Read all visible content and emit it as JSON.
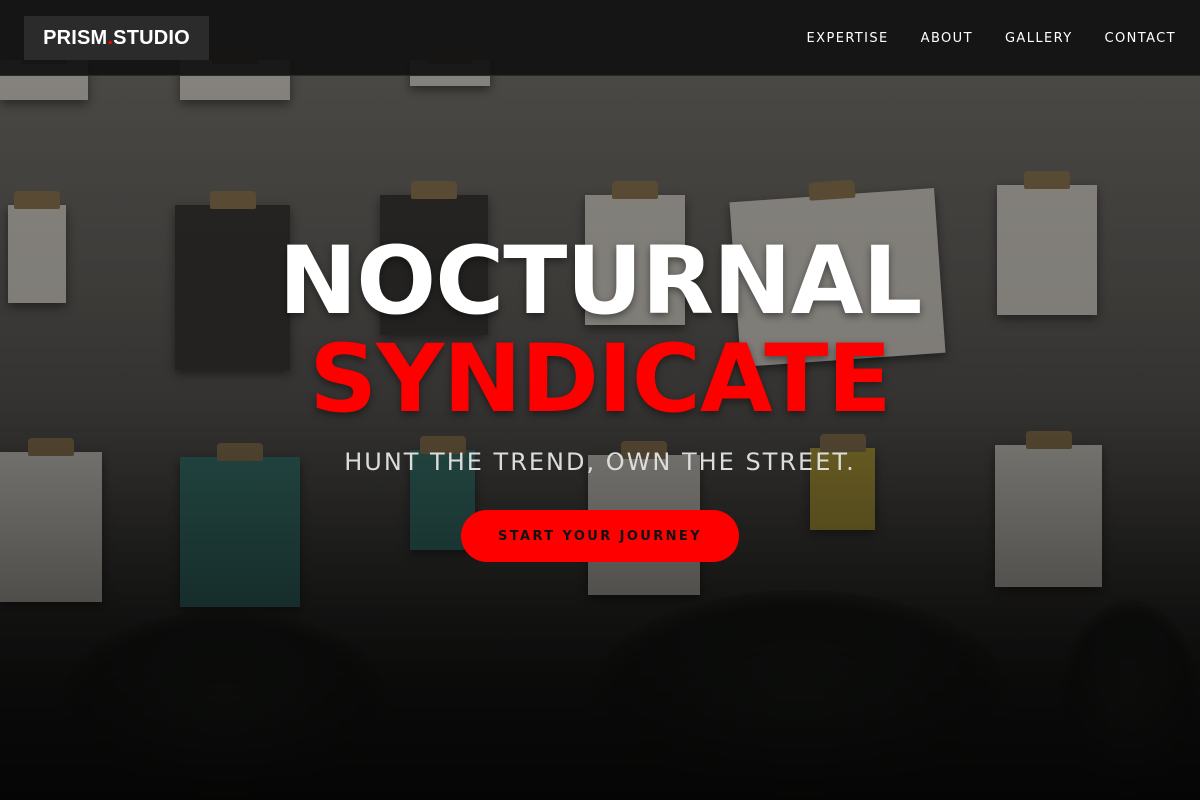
{
  "brand": {
    "name_part1": "PRISM",
    "dot": ".",
    "name_part2": "STUDIO",
    "accent_color": "#ff0000"
  },
  "nav": {
    "items": [
      {
        "label": "EXPERTISE"
      },
      {
        "label": "ABOUT"
      },
      {
        "label": "GALLERY"
      },
      {
        "label": "CONTACT"
      }
    ]
  },
  "hero": {
    "title_line1": "NOCTURNAL",
    "title_line2": "SYNDICATE",
    "tagline": "HUNT THE TREND, OWN THE STREET.",
    "cta_label": "START YOUR JOURNEY",
    "title_color": "#ffffff",
    "accent_color": "#ff0000",
    "background_image": "wall-of-clipboards-photo"
  }
}
